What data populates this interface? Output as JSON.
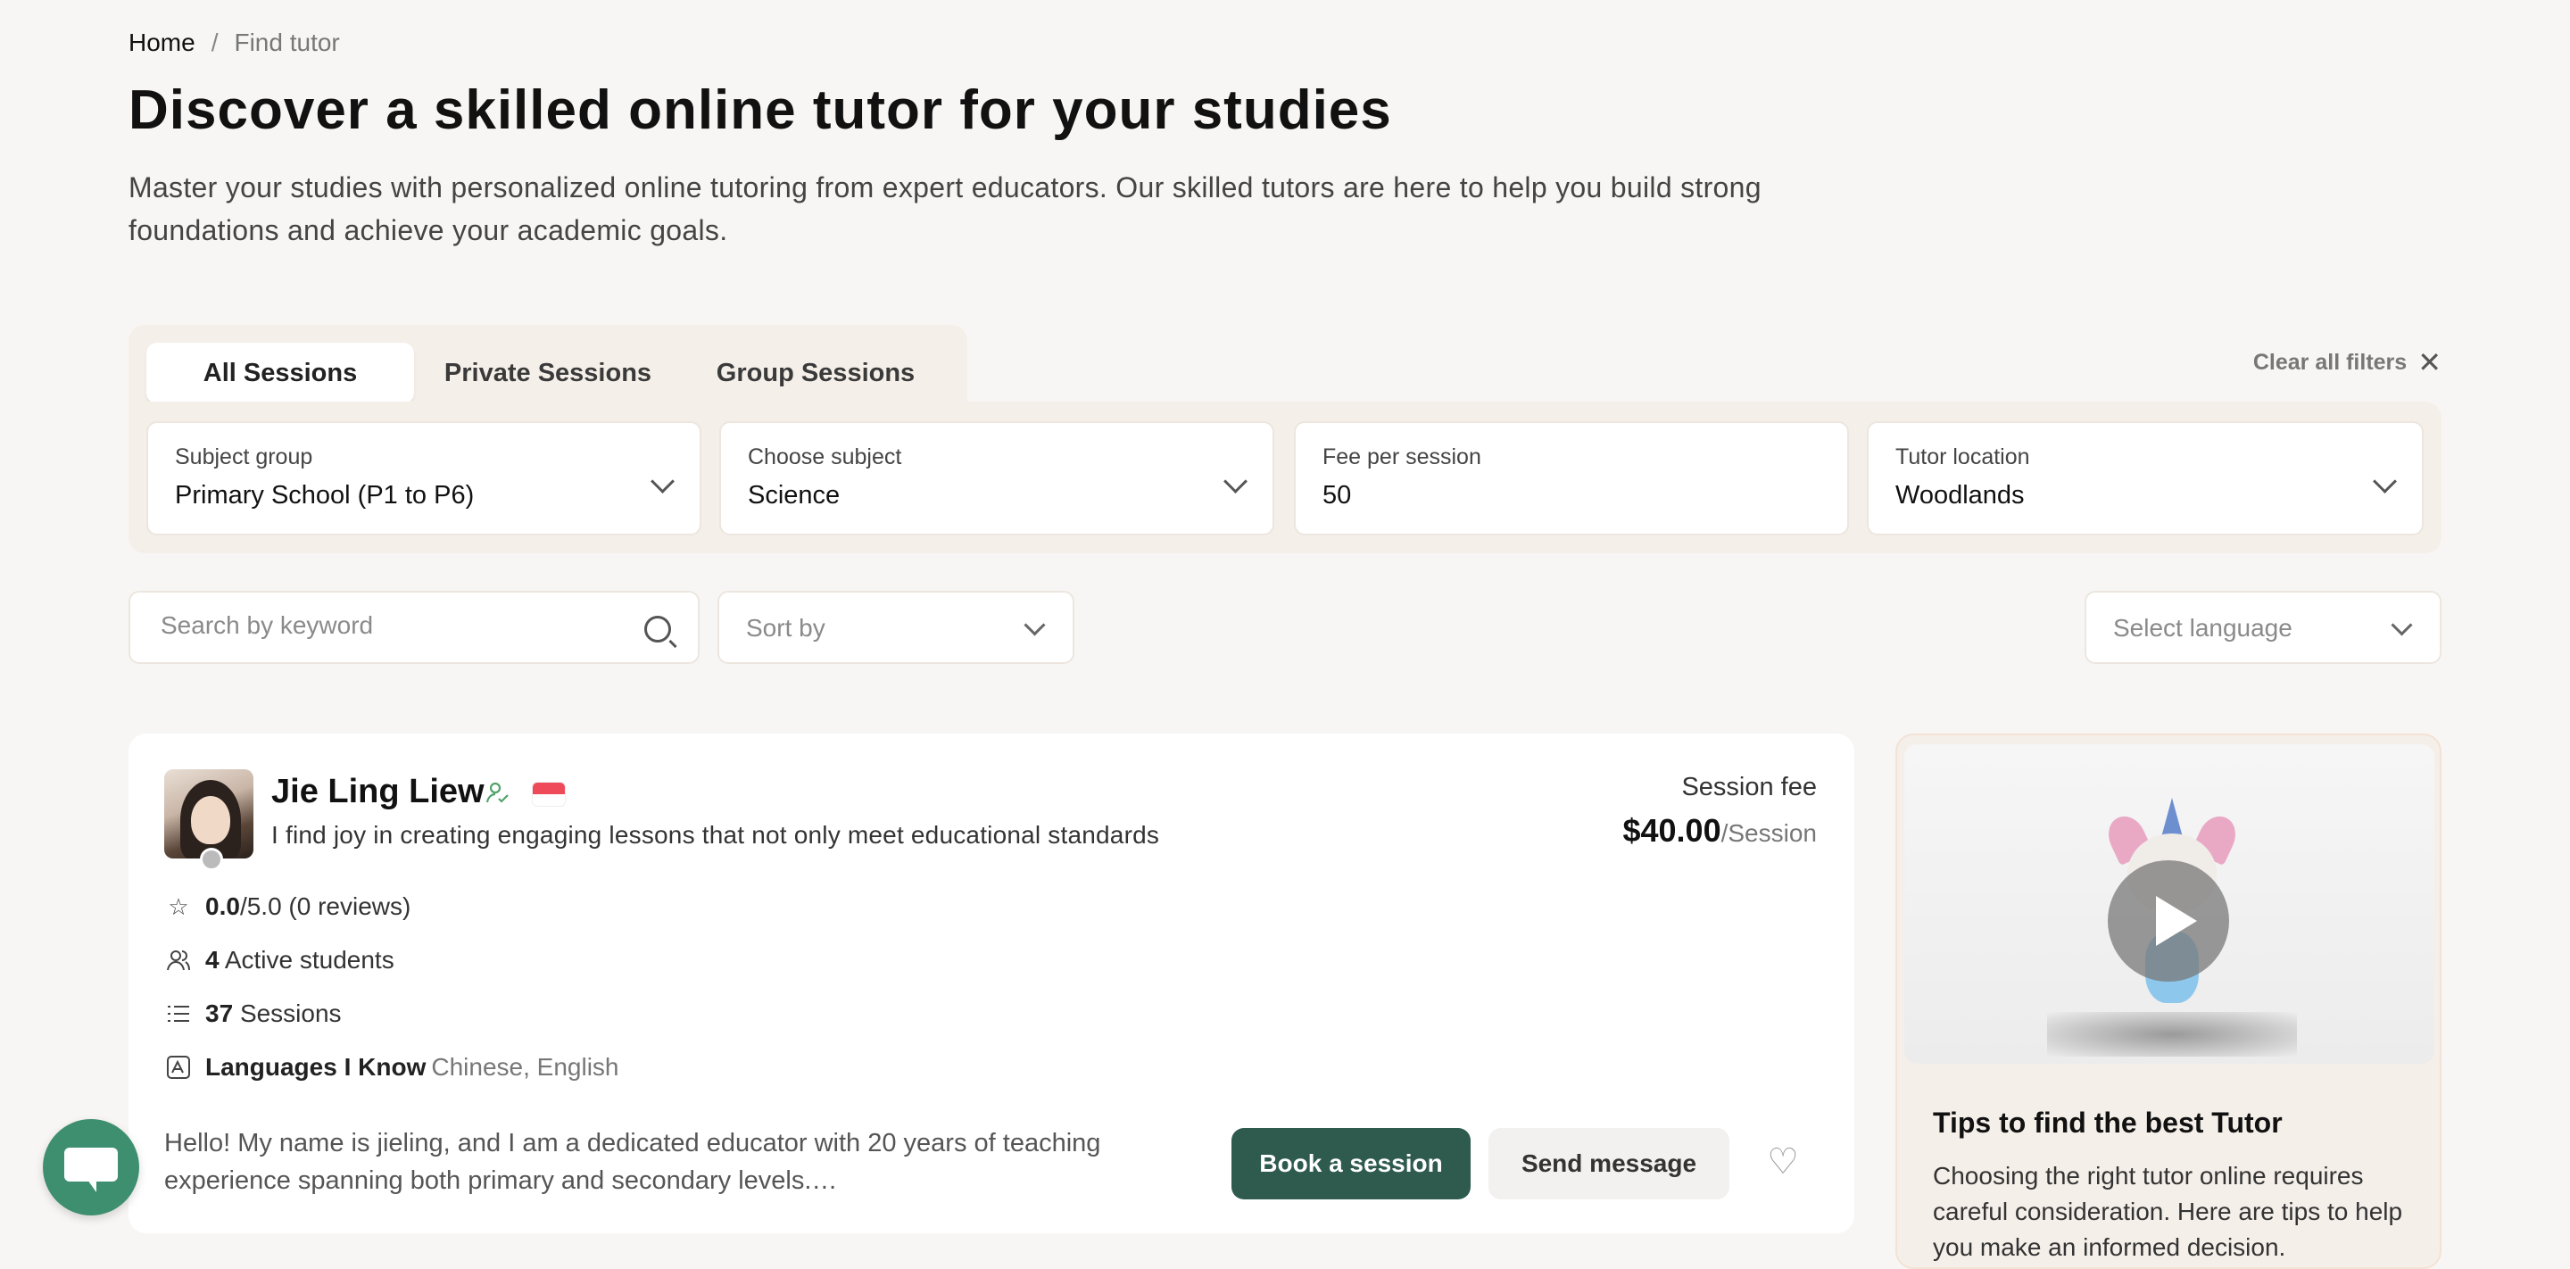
{
  "breadcrumb": {
    "home": "Home",
    "separator": "/",
    "current": "Find tutor"
  },
  "header": {
    "title": "Discover a skilled online tutor for your studies",
    "subtitle": "Master your studies with personalized online tutoring from expert educators. Our skilled tutors are here to help you build strong foundations and achieve your academic goals."
  },
  "tabs": [
    {
      "label": "All Sessions",
      "active": true
    },
    {
      "label": "Private Sessions",
      "active": false
    },
    {
      "label": "Group Sessions",
      "active": false
    }
  ],
  "clear_filters": "Clear all filters",
  "filters": {
    "subject_group": {
      "label": "Subject group",
      "value": "Primary School (P1 to P6)"
    },
    "subject": {
      "label": "Choose subject",
      "value": "Science"
    },
    "fee": {
      "label": "Fee per session",
      "value": "50"
    },
    "location": {
      "label": "Tutor location",
      "value": "Woodlands"
    }
  },
  "search": {
    "placeholder": "Search by keyword"
  },
  "sort": {
    "placeholder": "Sort by"
  },
  "language": {
    "placeholder": "Select language"
  },
  "tutor": {
    "name": "Jie Ling Liew",
    "tagline": "I find joy in creating engaging lessons that not only meet educational standards",
    "fee_label": "Session fee",
    "fee_value": "$40.00",
    "fee_unit": "/Session",
    "rating_value": "0.0",
    "rating_rest": "/5.0 (0 reviews)",
    "students_count": "4",
    "students_label": "Active students",
    "sessions_count": "37",
    "sessions_label": "Sessions",
    "languages_label": "Languages I Know",
    "languages_value": "Chinese, English",
    "bio": "Hello! My name is jieling, and I am a dedicated educator with 20 years of teaching experience spanning both primary and secondary levels.…",
    "book_label": "Book a session",
    "message_label": "Send message"
  },
  "tips": {
    "title": "Tips to find the best Tutor",
    "text": "Choosing the right tutor online requires careful consideration. Here are tips to help you make an informed decision."
  },
  "icons": {
    "search": "search-icon",
    "chevron": "chevron-down-icon",
    "close": "close-icon",
    "star": "star-icon",
    "users": "users-icon",
    "list": "list-icon",
    "language": "language-icon",
    "heart": "heart-icon",
    "play": "play-icon",
    "chat": "chat-icon"
  },
  "colors": {
    "accent": "#2f5a4e",
    "chat": "#3e8f6f",
    "panel": "#f5efe9",
    "background": "#f8f6f4"
  }
}
